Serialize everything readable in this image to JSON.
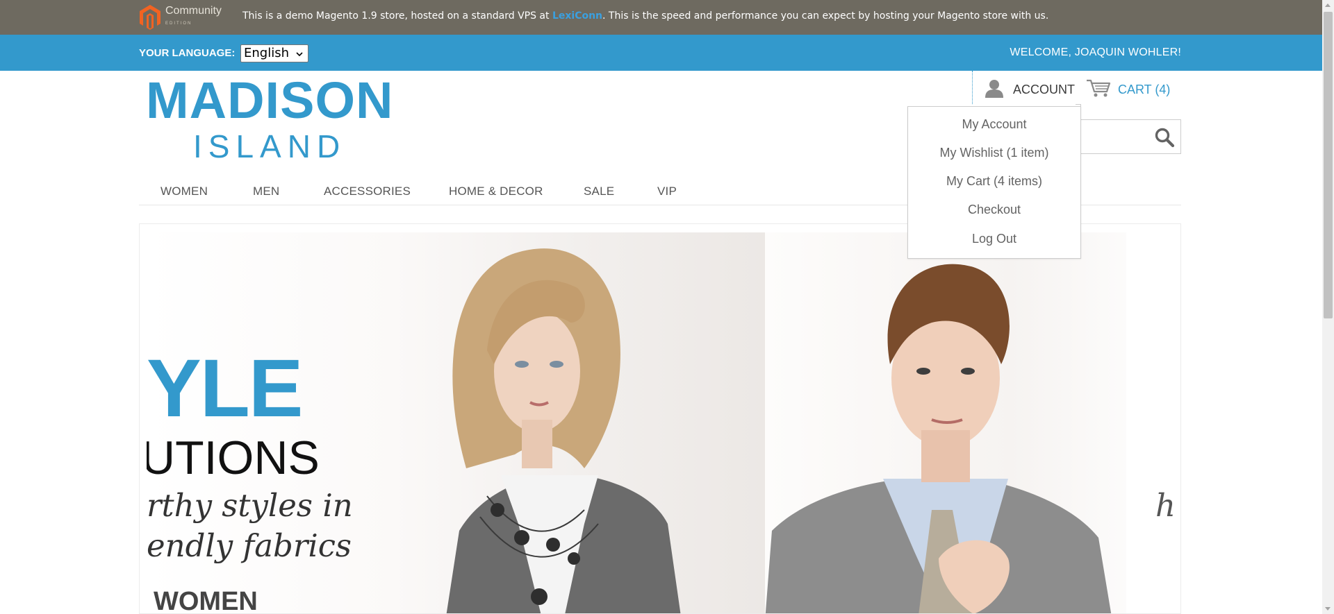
{
  "demo_bar": {
    "logo_text": "Community",
    "logo_subtext": "EDITION",
    "message_before": "This is a demo Magento 1.9 store, hosted on a standard VPS at ",
    "message_link": "LexiConn",
    "message_after": ". This is the speed and performance you can expect by hosting your Magento store with us."
  },
  "header": {
    "language_label": "YOUR LANGUAGE:",
    "language_value": "English",
    "welcome": "WELCOME, JOAQUIN WOHLER!"
  },
  "logo": {
    "line1": "MADISON",
    "line2": "ISLAND"
  },
  "account": {
    "label": "ACCOUNT",
    "icon": "person-icon"
  },
  "cart": {
    "label": "CART (4)",
    "icon": "shopping-cart-icon"
  },
  "search": {
    "icon": "magnifier-icon"
  },
  "nav": [
    "WOMEN",
    "MEN",
    "ACCESSORIES",
    "HOME & DECOR",
    "SALE",
    "VIP"
  ],
  "account_menu": [
    "My Account",
    "My Wishlist (1 item)",
    "My Cart (4 items)",
    "Checkout",
    "Log Out"
  ],
  "hero": {
    "headline": "YLE",
    "subhead": "UTIONS",
    "tagline1": "rthy styles in",
    "tagline2": "endly fabrics",
    "category": "WOMEN",
    "right_text": "hi"
  },
  "colors": {
    "demo_bar": "#6e6a60",
    "header_blue": "#3399cc",
    "link_blue": "#3399cc"
  }
}
